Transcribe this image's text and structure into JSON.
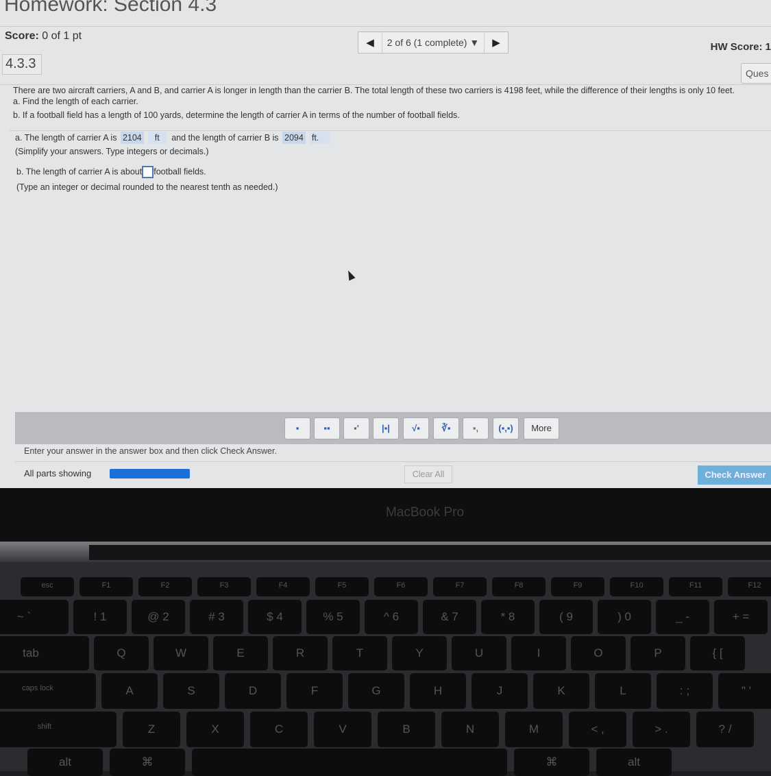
{
  "header": {
    "title": "Homework: Section 4.3",
    "score_label": "Score:",
    "score_value": "0 of 1 pt",
    "nav_status": "2 of 6 (1 complete)",
    "hw_score": "HW Score: 1",
    "question_number": "4.3.3",
    "question_button": "Ques"
  },
  "problem": {
    "intro": "There are two aircraft carriers, A and B, and carrier A is longer in length than the carrier B. The total length of these two carriers is 4198 feet, while the difference of their lengths is only 10 feet.",
    "part_a": "a. Find the length of each carrier.",
    "part_b": "b. If a football field has a length of 100 yards, determine the length of carrier A in terms of the number of football fields."
  },
  "answers": {
    "a_prefix": "a. The length of carrier A is",
    "a_value": "2104",
    "a_unit": "ft",
    "a_middle": "and the length of carrier B is",
    "b_value": "2094",
    "b_unit": "ft.",
    "a_hint": "(Simplify your answers. Type integers or decimals.)",
    "b_prefix": "b. The length of carrier A is about",
    "b_value_field": "",
    "b_suffix": "football fields.",
    "b_hint": "(Type an integer or decimal rounded to the nearest tenth as needed.)"
  },
  "toolbar": {
    "buttons": [
      "fraction",
      "mixed-number",
      "exponent",
      "absolute-value",
      "square-root",
      "nth-root",
      "decimal",
      "ordered-pair"
    ],
    "more_label": "More"
  },
  "footer": {
    "instruction": "Enter your answer in the answer box and then click Check Answer.",
    "parts_label": "All parts showing",
    "progress": 1.0,
    "clear_label": "Clear All",
    "check_label": "Check Answer",
    "accent": "#6eb0da"
  },
  "laptop": {
    "brand": "MacBook Pro"
  },
  "keyboard": {
    "rows": [
      [
        "esc",
        "F1",
        "F2",
        "F3",
        "F4",
        "F5",
        "F6",
        "F7",
        "F8",
        "F9",
        "F10",
        "F11",
        "F12"
      ],
      [
        "~ `",
        "! 1",
        "@ 2",
        "# 3",
        "$ 4",
        "% 5",
        "^ 6",
        "& 7",
        "* 8",
        "( 9",
        ") 0",
        "_ -",
        "+ ="
      ],
      [
        "tab",
        "Q",
        "W",
        "E",
        "R",
        "T",
        "Y",
        "U",
        "I",
        "O",
        "P",
        "{ ["
      ],
      [
        "caps lock",
        "A",
        "S",
        "D",
        "F",
        "G",
        "H",
        "J",
        "K",
        "L",
        ": ;",
        "\" '"
      ],
      [
        "shift",
        "Z",
        "X",
        "C",
        "V",
        "B",
        "N",
        "M",
        "< ,",
        "> .",
        "? /"
      ],
      [
        "alt",
        "⌘",
        "",
        "⌘",
        "alt"
      ]
    ]
  }
}
